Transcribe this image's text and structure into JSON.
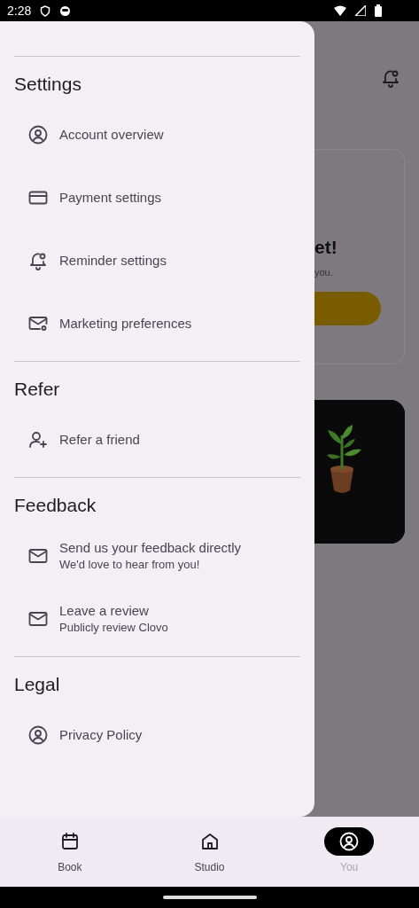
{
  "status_bar": {
    "time": "2:28"
  },
  "drawer": {
    "sections": [
      {
        "title": "Settings",
        "items": [
          {
            "label": "Account overview"
          },
          {
            "label": "Payment settings"
          },
          {
            "label": "Reminder settings"
          },
          {
            "label": "Marketing preferences"
          }
        ]
      },
      {
        "title": "Refer",
        "items": [
          {
            "label": "Refer a friend"
          }
        ]
      },
      {
        "title": "Feedback",
        "items": [
          {
            "label": "Send us your feedback directly",
            "subtitle": "We'd love to hear from you!"
          },
          {
            "label": "Leave a review",
            "subtitle": "Publicly review Clovo"
          }
        ]
      },
      {
        "title": "Legal",
        "items": [
          {
            "label": "Privacy Policy"
          }
        ]
      }
    ]
  },
  "background": {
    "card": {
      "title": "et!",
      "text": "you."
    }
  },
  "bottom_nav": [
    {
      "label": "Book",
      "selected": false
    },
    {
      "label": "Studio",
      "selected": false
    },
    {
      "label": "You",
      "selected": true
    }
  ]
}
